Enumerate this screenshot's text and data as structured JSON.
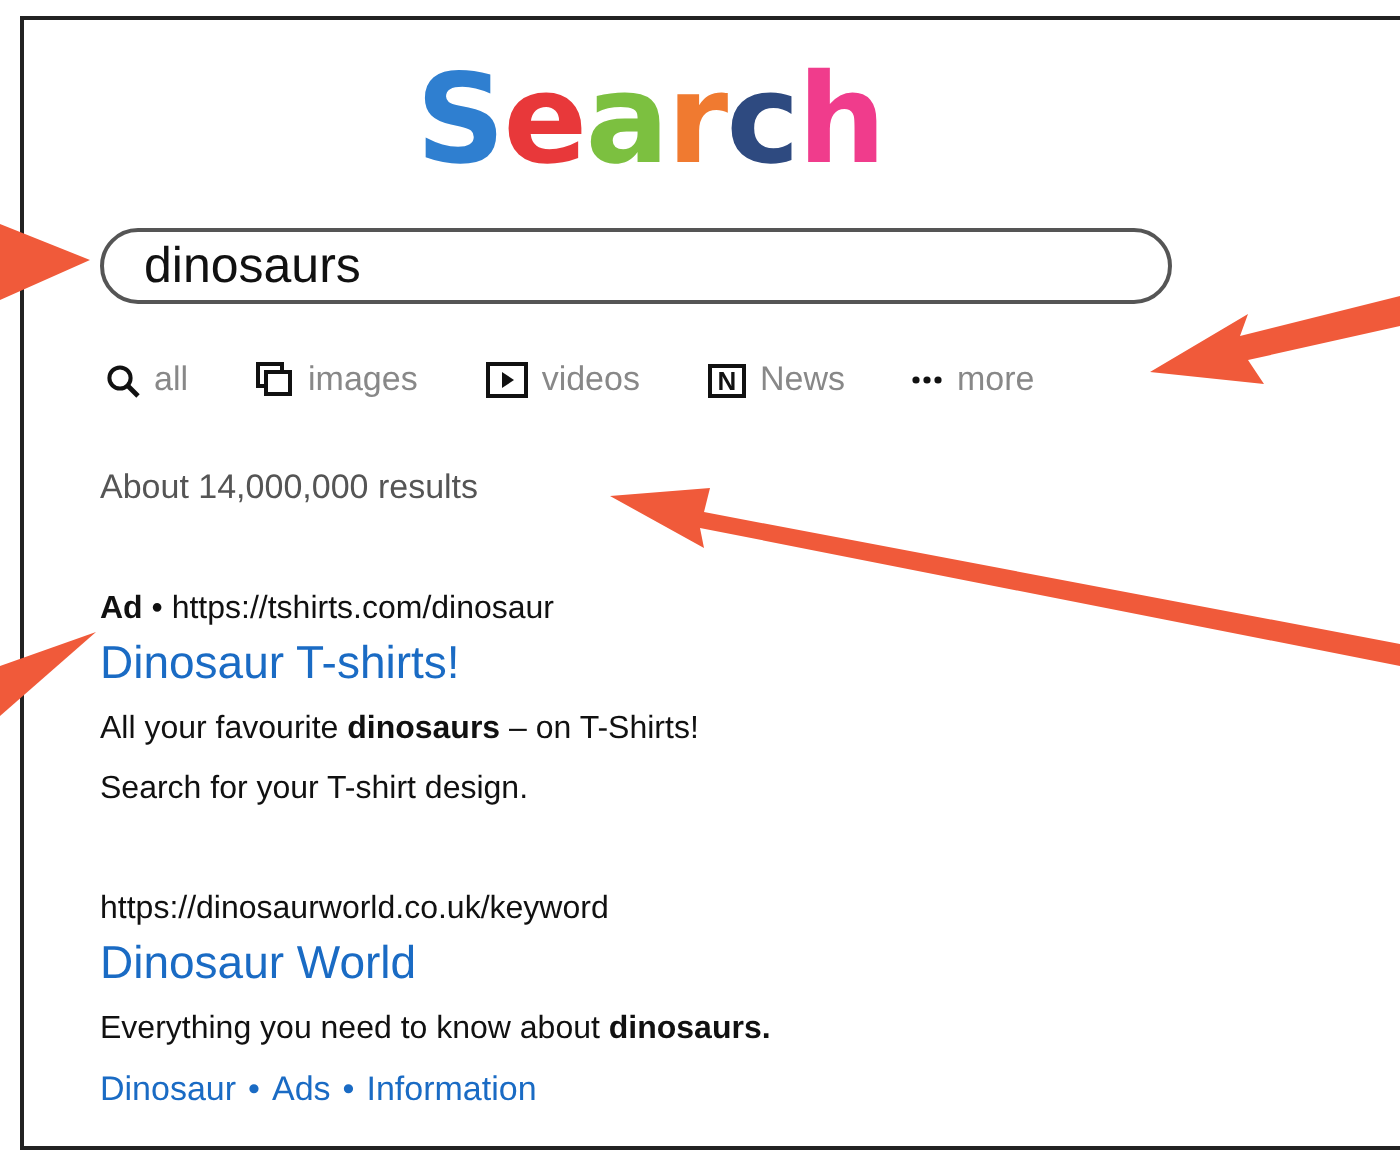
{
  "logo": {
    "letters": [
      {
        "char": "S",
        "color": "#2f7fd0"
      },
      {
        "char": "e",
        "color": "#e8383a"
      },
      {
        "char": "a",
        "color": "#7cc040"
      },
      {
        "char": "r",
        "color": "#f07a30"
      },
      {
        "char": "c",
        "color": "#2e4a80"
      },
      {
        "char": "h",
        "color": "#f03c8c"
      }
    ]
  },
  "search": {
    "value": "dinosaurs"
  },
  "tabs": [
    {
      "kind": "all",
      "label": "all"
    },
    {
      "kind": "images",
      "label": "images"
    },
    {
      "kind": "videos",
      "label": "videos"
    },
    {
      "kind": "news",
      "badge": "N",
      "label": "News"
    },
    {
      "kind": "more",
      "label": "more"
    }
  ],
  "result_count": "About 14,000,000 results",
  "results": [
    {
      "url": "**Ad** • https://tshirts.com/dinosaur",
      "title": "Dinosaur T-shirts!",
      "lines": [
        "All your favourite **dinosaurs** – on T-Shirts!",
        "Search for your T-shirt design."
      ]
    },
    {
      "url": "https://dinosaurworld.co.uk/keyword",
      "title": "Dinosaur World",
      "lines": [
        "Everything you need to know about **dinosaurs.**"
      ],
      "sitelinks": [
        "Dinosaur",
        "Ads",
        "Information"
      ],
      "separator": "•"
    }
  ]
}
